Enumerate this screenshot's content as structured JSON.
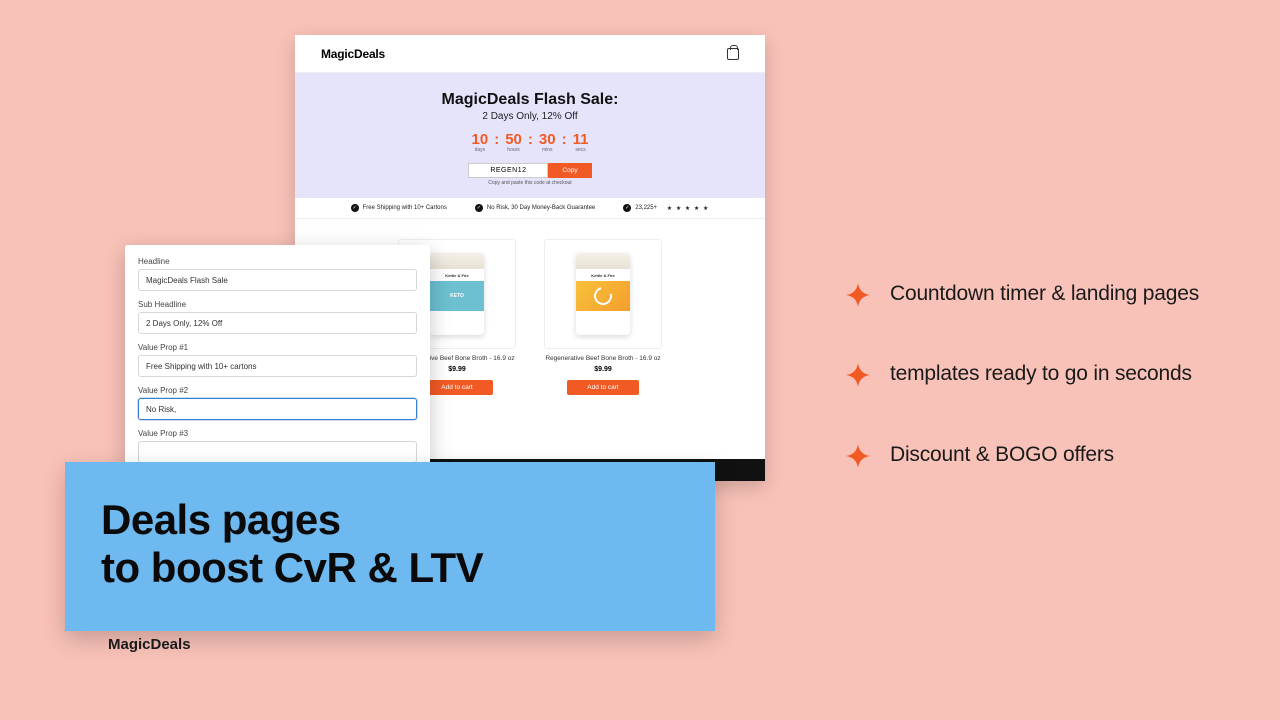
{
  "brand": "MagicDeals",
  "preview": {
    "headline": "MagicDeals Flash Sale:",
    "subheadline": "2 Days Only, 12% Off",
    "timer": {
      "days": {
        "value": "10",
        "label": "days"
      },
      "hours": {
        "value": "50",
        "label": "hours"
      },
      "mins": {
        "value": "30",
        "label": "mins"
      },
      "secs": {
        "value": "11",
        "label": "secs"
      }
    },
    "promo_code": "REGEN12",
    "copy_button": "Copy",
    "promo_hint": "Copy and paste this code at checkout",
    "benefits": {
      "b1": "Free Shipping with 10+ Cartons",
      "b2": "No Risk, 30 Day Money-Back Guarantee",
      "b3_count": "23,225+",
      "b3_stars": "★ ★ ★ ★ ★"
    },
    "products": [
      {
        "name": "Regenerative Beef Bone Broth - 16.9 oz",
        "price": "$9.99",
        "cta": "Add to cart",
        "carton_logo": "Kettle & Fire",
        "carton_band": "KETO"
      },
      {
        "name": "Regenerative Beef Bone Broth - 16.9 oz",
        "price": "$9.99",
        "cta": "Add to cart",
        "carton_logo": "Kettle & Fire",
        "carton_band": ""
      }
    ]
  },
  "editor": {
    "headline_label": "Headline",
    "headline_value": "MagicDeals Flash Sale",
    "sub_label": "Sub Headline",
    "sub_value": "2 Days Only, 12% Off",
    "vp1_label": "Value Prop #1",
    "vp1_value": "Free Shipping with 10+ cartons",
    "vp2_label": "Value Prop #2",
    "vp2_value": "No Risk,",
    "vp3_label": "Value Prop #3",
    "vp3_value": ""
  },
  "slogan": {
    "line1": "Deals pages",
    "line2": "to boost CvR & LTV"
  },
  "features": [
    "Countdown timer & landing pages",
    "templates ready to go in seconds",
    "Discount & BOGO offers"
  ],
  "colors": {
    "accent": "#f15a24"
  }
}
